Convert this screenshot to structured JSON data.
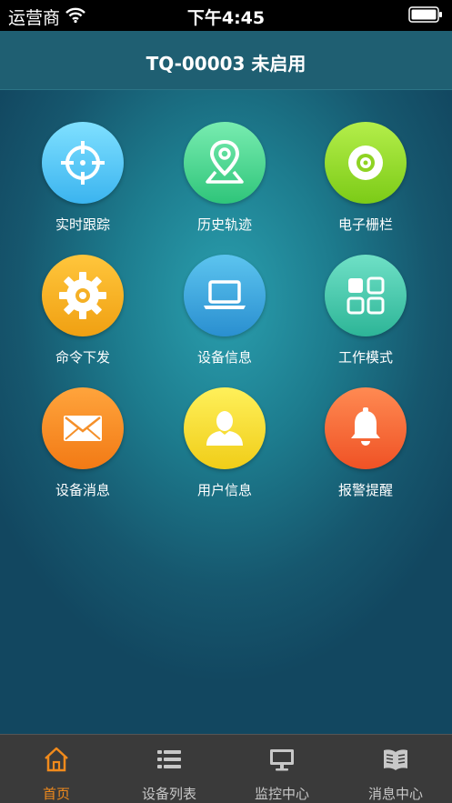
{
  "status": {
    "carrier": "运营商",
    "time": "下午4:45"
  },
  "header": {
    "title": "TQ-00003 未启用"
  },
  "menu": [
    {
      "label": "实时跟踪",
      "icon": "crosshair-icon",
      "color_top": "#7fe0ff",
      "color_bottom": "#3bb4ef"
    },
    {
      "label": "历史轨迹",
      "icon": "map-pin-icon",
      "color_top": "#78ecb0",
      "color_bottom": "#2fc57a"
    },
    {
      "label": "电子栅栏",
      "icon": "target-disc-icon",
      "color_top": "#b4ee4a",
      "color_bottom": "#7ccb17"
    },
    {
      "label": "命令下发",
      "icon": "gear-icon",
      "color_top": "#ffc63c",
      "color_bottom": "#f0a012"
    },
    {
      "label": "设备信息",
      "icon": "laptop-icon",
      "color_top": "#5cc4ef",
      "color_bottom": "#2a8fd0"
    },
    {
      "label": "工作模式",
      "icon": "grid-icon",
      "color_top": "#6fe0c6",
      "color_bottom": "#2db597"
    },
    {
      "label": "设备消息",
      "icon": "envelope-icon",
      "color_top": "#ffa43c",
      "color_bottom": "#f27a15"
    },
    {
      "label": "用户信息",
      "icon": "user-icon",
      "color_top": "#fff05a",
      "color_bottom": "#f0cd18"
    },
    {
      "label": "报警提醒",
      "icon": "bell-icon",
      "color_top": "#ff8a52",
      "color_bottom": "#ef5225"
    }
  ],
  "tabs": [
    {
      "label": "首页",
      "icon": "home-icon",
      "active": true
    },
    {
      "label": "设备列表",
      "icon": "list-icon",
      "active": false
    },
    {
      "label": "监控中心",
      "icon": "monitor-icon",
      "active": false
    },
    {
      "label": "消息中心",
      "icon": "book-icon",
      "active": false
    }
  ],
  "colors": {
    "active_tab": "#f08a1c",
    "inactive_tab": "#c8c8c8",
    "navbar": "#1f5f72"
  }
}
